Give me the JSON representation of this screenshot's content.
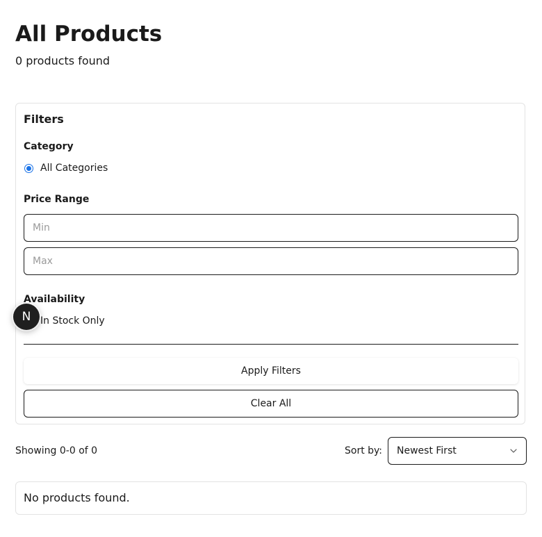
{
  "page": {
    "title": "All Products",
    "count_text": "0 products found"
  },
  "filters": {
    "heading": "Filters",
    "category": {
      "label": "Category",
      "options": [
        {
          "label": "All Categories",
          "selected": true
        }
      ]
    },
    "price_range": {
      "label": "Price Range",
      "min": {
        "value": "",
        "placeholder": "Min"
      },
      "max": {
        "value": "",
        "placeholder": "Max"
      }
    },
    "availability": {
      "label": "Availability",
      "in_stock_label": "In Stock Only",
      "in_stock_checked": false
    },
    "apply_label": "Apply Filters",
    "clear_label": "Clear All"
  },
  "results": {
    "showing_text": "Showing 0-0 of 0",
    "sort_label": "Sort by:",
    "sort_value": "Newest First",
    "empty_text": "No products found."
  },
  "dev_badge": {
    "letter": "N"
  },
  "colors": {
    "accent": "#1a73e8",
    "border": "#1a1a1a",
    "panel_border": "#e3e3e3",
    "text": "#1a1a1a",
    "badge_bg": "#1f1f1f"
  }
}
